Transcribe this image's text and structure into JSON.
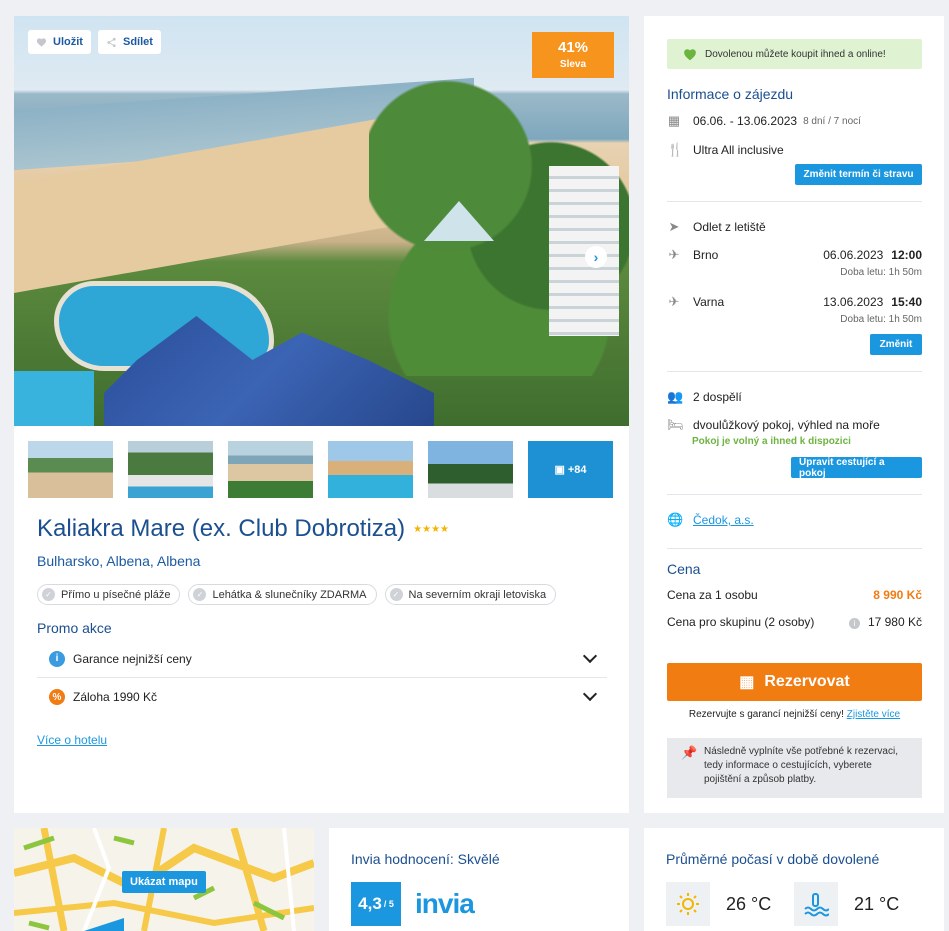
{
  "hero": {
    "save_label": "Uložit",
    "share_label": "Sdílet",
    "discount_pct": "41%",
    "discount_label": "Sleva",
    "more_photos": "+84"
  },
  "hotel": {
    "name": "Kaliakra Mare (ex. Club Dobrotiza)",
    "stars": "★★★★",
    "location": "Bulharsko, Albena, Albena",
    "tags": [
      "Přímo u písečné pláže",
      "Lehátka & slunečníky ZDARMA",
      "Na severním okraji letoviska"
    ],
    "promo_heading": "Promo akce",
    "promo_items": [
      "Garance nejnižší ceny",
      "Záloha 1990 Kč"
    ],
    "more_link": "Více o hotelu"
  },
  "sidebar": {
    "banner": "Dovolenou můžete koupit ihned a online!",
    "info_heading": "Informace o zájezdu",
    "dates": "06.06. - 13.06.2023",
    "dates_note": "8 dní / 7 nocí",
    "board": "Ultra All inclusive",
    "change_board_btn": "Změnit termín či stravu",
    "departure_heading": "Odlet z letiště",
    "flights": [
      {
        "city": "Brno",
        "date": "06.06.2023",
        "time": "12:00",
        "duration": "Doba letu: 1h 50m"
      },
      {
        "city": "Varna",
        "date": "13.06.2023",
        "time": "15:40",
        "duration": "Doba letu: 1h 50m"
      }
    ],
    "change_flight_btn": "Změnit",
    "travelers": "2 dospělí",
    "room": "dvoulůžkový pokoj, výhled na moře",
    "room_status": "Pokoj je volný a ihned k dispozici",
    "edit_travelers_btn": "Upravit cestující a pokoj",
    "operator": "Čedok, a.s.",
    "price_heading": "Cena",
    "price_person_label": "Cena za 1 osobu",
    "price_person": "8 990 Kč",
    "price_group_label": "Cena pro skupinu (2 osoby)",
    "price_group": "17 980 Kč",
    "reserve_btn": "Rezervovat",
    "reserve_note": "Rezervujte s garancí nejnižší ceny!",
    "reserve_link": "Zjistěte více",
    "grey_note": "Následně vyplníte vše potřebné k rezervaci, tedy informace o cestujících, vyberete pojištění a způsob platby."
  },
  "map": {
    "button": "Ukázat mapu"
  },
  "rating": {
    "heading": "Invia hodnocení: Skvělé",
    "score": "4,3",
    "score_max": "/ 5",
    "brand": "invia"
  },
  "weather": {
    "heading": "Průměrné počasí v době dovolené",
    "air_temp": "26 °C",
    "water_temp": "21 °C"
  }
}
